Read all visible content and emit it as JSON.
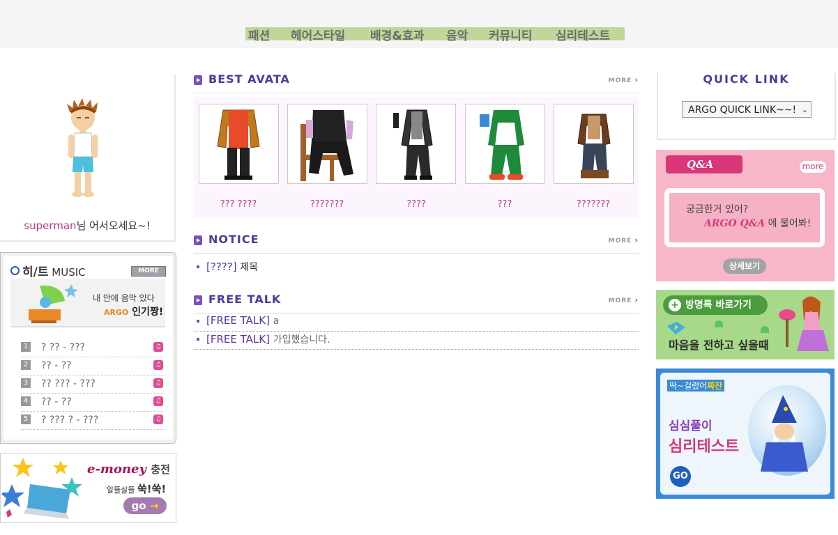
{
  "nav": {
    "items": [
      "패션",
      "헤어스타일",
      "배경&효과",
      "음악",
      "커뮤니티",
      "심리테스트"
    ]
  },
  "profile": {
    "username": "superman",
    "greeting_suffix": "님 어서오세요~!"
  },
  "music": {
    "title_bold": "히/트",
    "title_rest": "MUSIC",
    "more": "MORE",
    "banner_line1": "내 안에 음악 있다",
    "banner_brand": "ARGO",
    "banner_line2": "인기짱!",
    "songs": [
      {
        "num": "1",
        "title": "? ?? - ???"
      },
      {
        "num": "2",
        "title": "?? - ??"
      },
      {
        "num": "3",
        "title": "?? ??? - ???"
      },
      {
        "num": "4",
        "title": "?? - ??"
      },
      {
        "num": "5",
        "title": "? ??? ? - ???"
      }
    ]
  },
  "emoney": {
    "brand": "e-money",
    "label": "충전",
    "tagline": "알뜰살뜰",
    "tagline_bold": "쑥!쑥!",
    "go": "go"
  },
  "best_avata": {
    "title": "BEST AVATA",
    "more": "MORE",
    "items": [
      {
        "caption": "??? ????",
        "color": "#c07a1c"
      },
      {
        "caption": "???????",
        "color": "#2a2a2a"
      },
      {
        "caption": "????",
        "color": "#3a3a3a"
      },
      {
        "caption": "???",
        "color": "#1e8a3a"
      },
      {
        "caption": "???????",
        "color": "#6b3d1e"
      }
    ]
  },
  "notice": {
    "title": "NOTICE",
    "more": "MORE",
    "items": [
      {
        "category": "[????]",
        "text": "제목"
      }
    ]
  },
  "free_talk": {
    "title": "FREE TALK",
    "more": "MORE",
    "items": [
      {
        "category": "[FREE TALK]",
        "text": "a"
      },
      {
        "category": "[FREE TALK]",
        "text": "가입했습니다."
      }
    ]
  },
  "quick_link": {
    "title": "QUICK LINK",
    "selected": "ARGO QUICK LINK~~!"
  },
  "qa": {
    "title": "Q&A",
    "more": "more",
    "line1": "궁금한거 있어?",
    "line2_brand": "ARGO Q&A",
    "line2_rest": " 에 물어봐!",
    "detail": "상세보기"
  },
  "guestbook": {
    "button": "방명록 바로가기",
    "text": "마음을 전하고 싶을때"
  },
  "psytest": {
    "top": "딱~걸렸어",
    "top_bold": "짜잔",
    "line1": "심심풀이",
    "line2": "심리테스트",
    "go": "GO"
  }
}
